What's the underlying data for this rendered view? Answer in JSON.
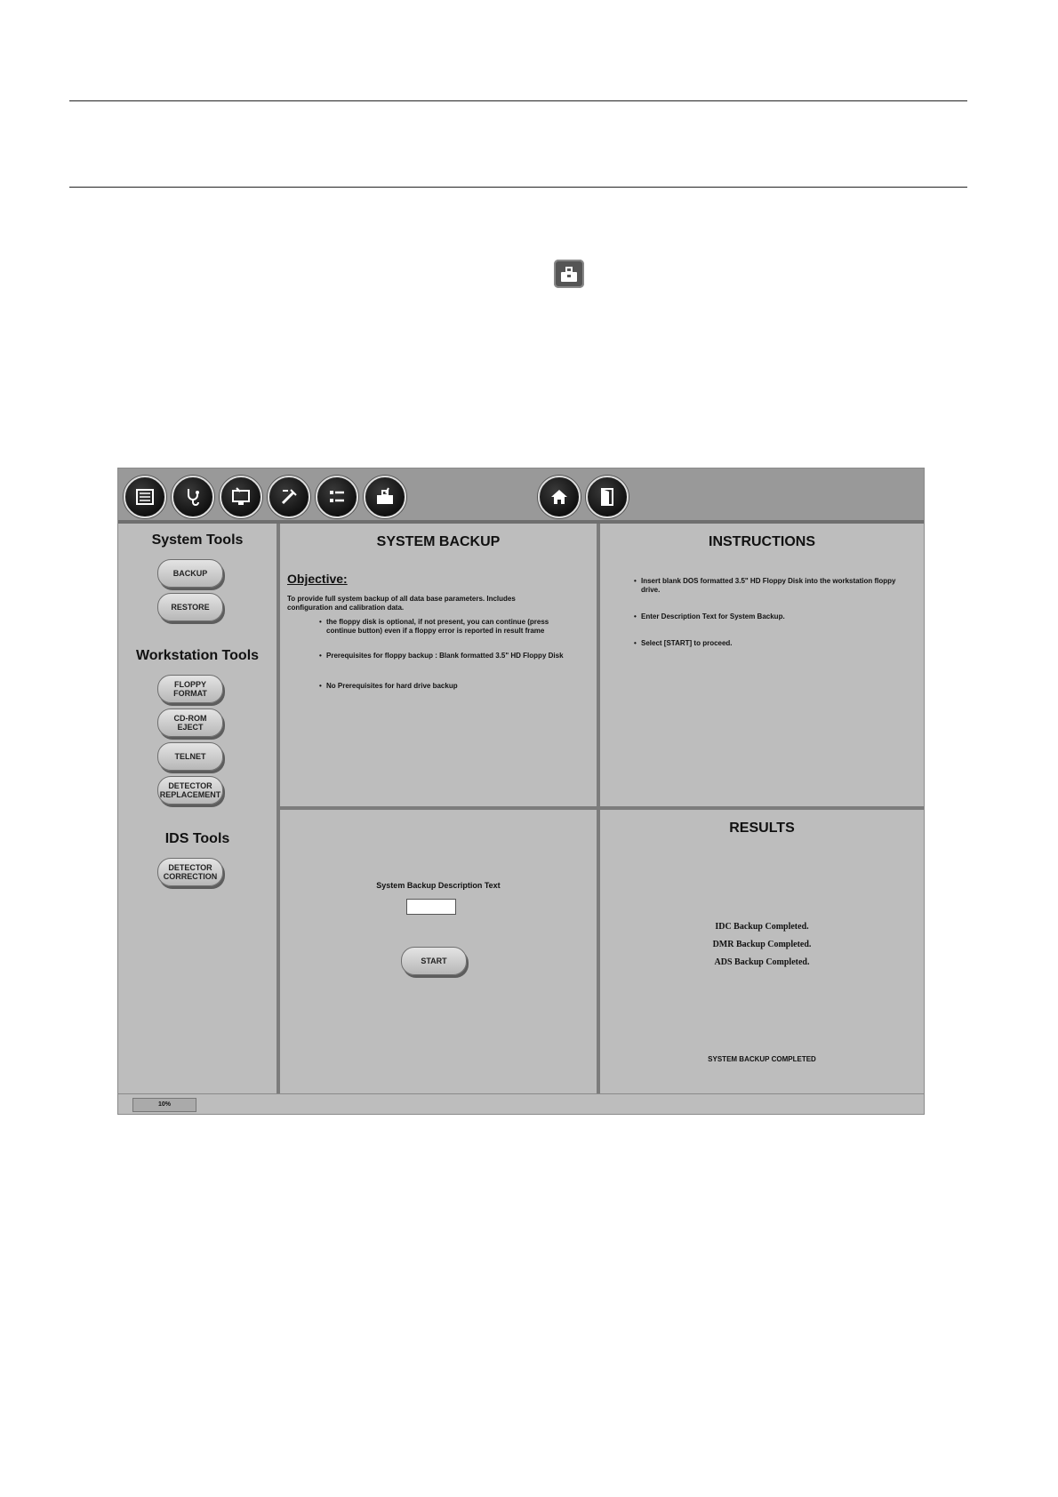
{
  "sidebar": {
    "system_tools_title": "System Tools",
    "backup": "BACKUP",
    "restore": "RESTORE",
    "workstation_tools_title": "Workstation Tools",
    "floppy_format": "FLOPPY\nFORMAT",
    "cdrom_eject": "CD-ROM\nEJECT",
    "telnet": "TELNET",
    "detector_replacement": "DETECTOR\nREPLACEMENT",
    "ids_tools_title": "IDS Tools",
    "detector_correction": "DETECTOR\nCORRECTION"
  },
  "backup_panel": {
    "title": "SYSTEM BACKUP",
    "objective_label": "Objective",
    "objective_colon": ":",
    "objective_text": "To provide full system backup of all data base parameters. Includes configuration and calibration data.",
    "bullets": [
      "the floppy disk is optional, if not present, you can continue (press continue button) even if a floppy error is reported in result frame",
      "Prerequisites for floppy backup : Blank formatted 3.5\" HD Floppy Disk",
      "No Prerequisites for hard drive backup"
    ]
  },
  "instructions_panel": {
    "title": "INSTRUCTIONS",
    "items": [
      "Insert blank DOS formatted 3.5\" HD Floppy Disk into the workstation floppy drive.",
      "Enter Description Text for System Backup.",
      "Select [START] to proceed."
    ]
  },
  "description_panel": {
    "label": "System Backup Description Text",
    "input_value": "",
    "start_label": "START"
  },
  "results_panel": {
    "title": "RESULTS",
    "lines": [
      "IDC Backup Completed.",
      "DMR Backup Completed.",
      "ADS Backup Completed."
    ],
    "final": "SYSTEM BACKUP COMPLETED"
  },
  "status": {
    "percent": "10%"
  },
  "icons": {
    "toolbar": [
      "list-icon",
      "stethoscope-icon",
      "monitor-icon",
      "calibration-icon",
      "checklist-icon",
      "toolbox-icon",
      "home-icon",
      "exit-door-icon"
    ],
    "page": "toolbox-icon"
  }
}
